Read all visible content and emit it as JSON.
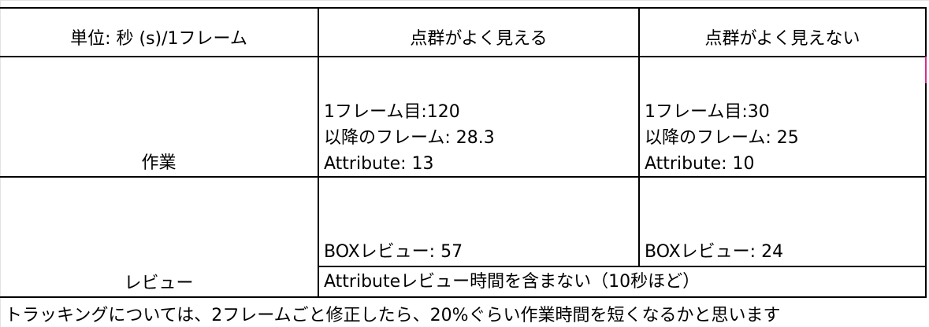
{
  "table": {
    "header": {
      "unit_label": "単位: 秒 (s)/1フレーム",
      "col_visible": "点群がよく見える",
      "col_not_visible": "点群がよく見えない"
    },
    "rows": {
      "work": {
        "label": "作業",
        "visible": {
          "line1": "1フレーム目:120",
          "line2": "以降のフレーム: 28.3",
          "line3": "Attribute: 13"
        },
        "not_visible": {
          "line1": "1フレーム目:30",
          "line2": "以降のフレーム: 25",
          "line3": "Attribute: 10"
        }
      },
      "review": {
        "label": "レビュー",
        "visible": "BOXレビュー: 57",
        "not_visible": "BOXレビュー: 24",
        "note": "Attributeレビュー時間を含まない（10秒ほど）"
      }
    },
    "footer_note": "トラッキングについては、2フレームごと修正したら、20%ぐらい作業時間を短くなるかと思います"
  },
  "colors": {
    "border": "#000000",
    "gridline": "#e2e2e2",
    "selection_mark": "#d62f8c"
  }
}
